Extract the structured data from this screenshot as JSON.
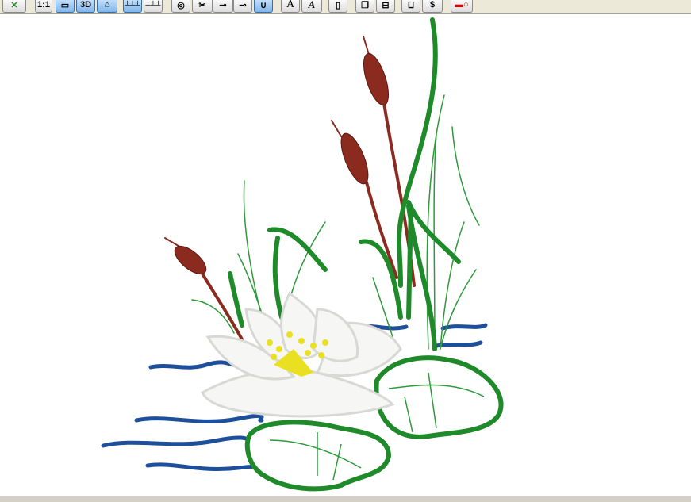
{
  "toolbar": {
    "buttons": [
      {
        "name": "magic-wand",
        "label": ""
      },
      {
        "name": "zoom-1-1",
        "label": "1:1"
      },
      {
        "name": "monitor-view",
        "label": ""
      },
      {
        "name": "3d-view",
        "label": "3D"
      },
      {
        "name": "hoop-view",
        "label": ""
      },
      {
        "name": "ruler-h",
        "label": ""
      },
      {
        "name": "ruler-v",
        "label": ""
      },
      {
        "name": "thread",
        "label": ""
      },
      {
        "name": "scissors",
        "label": ""
      },
      {
        "name": "stitch-point",
        "label": ""
      },
      {
        "name": "stitch-node",
        "label": ""
      },
      {
        "name": "select-hook",
        "label": ""
      },
      {
        "name": "text",
        "label": "A"
      },
      {
        "name": "text-edit",
        "label": "A"
      },
      {
        "name": "page",
        "label": ""
      },
      {
        "name": "copy-pages",
        "label": ""
      },
      {
        "name": "hierarchy",
        "label": ""
      },
      {
        "name": "cart",
        "label": ""
      },
      {
        "name": "price",
        "label": "$"
      },
      {
        "name": "key",
        "label": ""
      }
    ]
  },
  "colors": {
    "green": "#1f8a2a",
    "brown": "#8b2a1e",
    "blue": "#1e4f9a",
    "yellow": "#e8e020"
  }
}
